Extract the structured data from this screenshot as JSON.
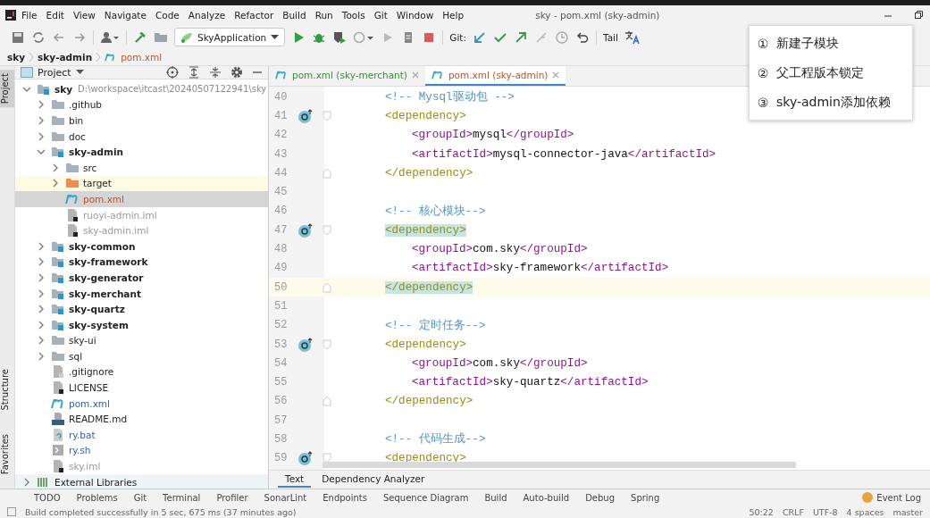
{
  "window": {
    "title": "sky - pom.xml (sky-admin)"
  },
  "menu": [
    "File",
    "Edit",
    "View",
    "Navigate",
    "Code",
    "Analyze",
    "Refactor",
    "Build",
    "Run",
    "Tools",
    "Git",
    "Window",
    "Help"
  ],
  "toolbar": {
    "run_config": "SkyApplication",
    "git_label": "Git:",
    "tail": "Tail"
  },
  "breadcrumb": [
    {
      "label": "sky",
      "kind": "module"
    },
    {
      "label": "sky-admin",
      "kind": "module"
    },
    {
      "label": "pom.xml",
      "kind": "maven"
    }
  ],
  "side_tabs": [
    {
      "label": "Project",
      "selected": true
    },
    {
      "label": "Structure",
      "selected": false
    },
    {
      "label": "Favorites",
      "selected": false
    }
  ],
  "project": {
    "title": "Project",
    "tree": [
      {
        "name": "sky",
        "hint": "D:\\workspace\\itcast\\20240507122941\\sky",
        "kind": "module",
        "bold": true,
        "expanded": true,
        "selected": false,
        "children": [
          {
            "name": ".github",
            "kind": "folder",
            "expanded": false,
            "selected": false
          },
          {
            "name": "bin",
            "kind": "folder",
            "expanded": false,
            "selected": false
          },
          {
            "name": "doc",
            "kind": "folder",
            "expanded": false,
            "selected": false
          },
          {
            "name": "sky-admin",
            "kind": "module",
            "bold": true,
            "expanded": true,
            "selected": false,
            "children": [
              {
                "name": "src",
                "kind": "folder",
                "expanded": false,
                "selected": false
              },
              {
                "name": "target",
                "kind": "excluded",
                "expanded": false,
                "selected": false
              },
              {
                "name": "pom.xml",
                "kind": "maven",
                "color": "#b5562e",
                "selected": true
              },
              {
                "name": "ruoyi-admin.iml",
                "kind": "iml",
                "color": "#9a9a9a",
                "selected": false
              },
              {
                "name": "sky-admin.iml",
                "kind": "iml",
                "color": "#9a9a9a",
                "selected": false
              }
            ]
          },
          {
            "name": "sky-common",
            "kind": "module",
            "bold": true,
            "expanded": false,
            "selected": false
          },
          {
            "name": "sky-framework",
            "kind": "module",
            "bold": true,
            "expanded": false,
            "selected": false
          },
          {
            "name": "sky-generator",
            "kind": "module",
            "bold": true,
            "expanded": false,
            "selected": false
          },
          {
            "name": "sky-merchant",
            "kind": "module",
            "bold": true,
            "expanded": false,
            "selected": false
          },
          {
            "name": "sky-quartz",
            "kind": "module",
            "bold": true,
            "expanded": false,
            "selected": false
          },
          {
            "name": "sky-system",
            "kind": "module",
            "bold": true,
            "expanded": false,
            "selected": false
          },
          {
            "name": "sky-ui",
            "kind": "folder",
            "expanded": false,
            "selected": false
          },
          {
            "name": "sql",
            "kind": "folder",
            "expanded": false,
            "selected": false
          },
          {
            "name": ".gitignore",
            "kind": "gitignore",
            "selected": false
          },
          {
            "name": "LICENSE",
            "kind": "text",
            "selected": false
          },
          {
            "name": "pom.xml",
            "kind": "maven",
            "color": "#2f5fb3",
            "selected": false
          },
          {
            "name": "README.md",
            "kind": "md",
            "selected": false
          },
          {
            "name": "ry.bat",
            "kind": "bat",
            "color": "#2f5fb3",
            "selected": false
          },
          {
            "name": "ry.sh",
            "kind": "sh",
            "color": "#2f5fb3",
            "selected": false
          },
          {
            "name": "sky.iml",
            "kind": "iml",
            "color": "#9a9a9a",
            "selected": false
          }
        ]
      },
      {
        "name": "External Libraries",
        "kind": "library",
        "expanded": false,
        "selected": false
      }
    ]
  },
  "editor": {
    "tabs": [
      {
        "label": "pom.xml (sky-merchant)",
        "color": "#3d8a3d",
        "selected": false
      },
      {
        "label": "pom.xml (sky-admin)",
        "color": "#b5562e",
        "selected": true
      }
    ],
    "lines": [
      {
        "no": "40",
        "parts": [
          {
            "kind": "comment",
            "text": "<!-- Mysql驱动包 -->"
          }
        ]
      },
      {
        "no": "41",
        "marker": true,
        "fold_start": true,
        "parts": [
          {
            "kind": "outer",
            "text": "<dependency>"
          }
        ]
      },
      {
        "no": "42",
        "parts": [
          {
            "kind": "inner",
            "text": "<groupId>"
          },
          {
            "kind": "text",
            "text": "mysql"
          },
          {
            "kind": "inner",
            "text": "</groupId>"
          }
        ]
      },
      {
        "no": "43",
        "parts": [
          {
            "kind": "inner",
            "text": "<artifactId>"
          },
          {
            "kind": "text",
            "text": "mysql-connector-java"
          },
          {
            "kind": "inner",
            "text": "</artifactId>"
          }
        ]
      },
      {
        "no": "44",
        "fold_end": true,
        "parts": [
          {
            "kind": "outer",
            "text": "</dependency>"
          }
        ]
      },
      {
        "no": "45"
      },
      {
        "no": "46",
        "parts": [
          {
            "kind": "comment",
            "text": "<!-- 核心模块-->"
          }
        ]
      },
      {
        "no": "47",
        "marker": true,
        "fold_start": true,
        "parts": [
          {
            "kind": "outer",
            "text": "<dependency>",
            "match": true
          }
        ]
      },
      {
        "no": "48",
        "parts": [
          {
            "kind": "inner",
            "text": "<groupId>"
          },
          {
            "kind": "text",
            "text": "com.sky"
          },
          {
            "kind": "inner",
            "text": "</groupId>"
          }
        ]
      },
      {
        "no": "49",
        "parts": [
          {
            "kind": "inner",
            "text": "<artifactId>"
          },
          {
            "kind": "text",
            "text": "sky-framework"
          },
          {
            "kind": "inner",
            "text": "</artifactId>"
          }
        ]
      },
      {
        "no": "50",
        "current": true,
        "fold_end": true,
        "parts": [
          {
            "kind": "outer",
            "text": "</dependency>",
            "match": true
          }
        ]
      },
      {
        "no": "51"
      },
      {
        "no": "52",
        "parts": [
          {
            "kind": "comment",
            "text": "<!-- 定时任务-->"
          }
        ]
      },
      {
        "no": "53",
        "marker": true,
        "fold_start": true,
        "parts": [
          {
            "kind": "outer",
            "text": "<dependency>"
          }
        ]
      },
      {
        "no": "54",
        "parts": [
          {
            "kind": "inner",
            "text": "<groupId>"
          },
          {
            "kind": "text",
            "text": "com.sky"
          },
          {
            "kind": "inner",
            "text": "</groupId>"
          }
        ]
      },
      {
        "no": "55",
        "parts": [
          {
            "kind": "inner",
            "text": "<artifactId>"
          },
          {
            "kind": "text",
            "text": "sky-quartz"
          },
          {
            "kind": "inner",
            "text": "</artifactId>"
          }
        ]
      },
      {
        "no": "56",
        "fold_end": true,
        "parts": [
          {
            "kind": "outer",
            "text": "</dependency>"
          }
        ]
      },
      {
        "no": "57"
      },
      {
        "no": "58",
        "parts": [
          {
            "kind": "comment",
            "text": "<!-- 代码生成-->"
          }
        ]
      },
      {
        "no": "59",
        "marker": true,
        "fold_start": true,
        "parts": [
          {
            "kind": "outer",
            "text": "<dependency>"
          }
        ]
      }
    ],
    "bottom_tabs": [
      {
        "label": "Text",
        "selected": true
      },
      {
        "label": "Dependency Analyzer",
        "selected": false
      }
    ]
  },
  "notes": [
    {
      "marker": "①",
      "text": "新建子模块"
    },
    {
      "marker": "②",
      "text": "父工程版本锁定"
    },
    {
      "marker": "③",
      "text": "sky-admin添加依赖"
    }
  ],
  "tool_windows": [
    "TODO",
    "Problems",
    "Git",
    "Terminal",
    "Profiler",
    "SonarLint",
    "Endpoints",
    "Sequence Diagram",
    "Build",
    "Auto-build",
    "Debug",
    "Spring"
  ],
  "event_log": "Event Log",
  "status_bar": {
    "message": "Build completed successfully in 5 sec, 675 ms (37 minutes ago)",
    "position": "50:22",
    "line_sep": "CRLF",
    "encoding": "UTF-8",
    "indent": "4 spaces",
    "branch": "master"
  }
}
